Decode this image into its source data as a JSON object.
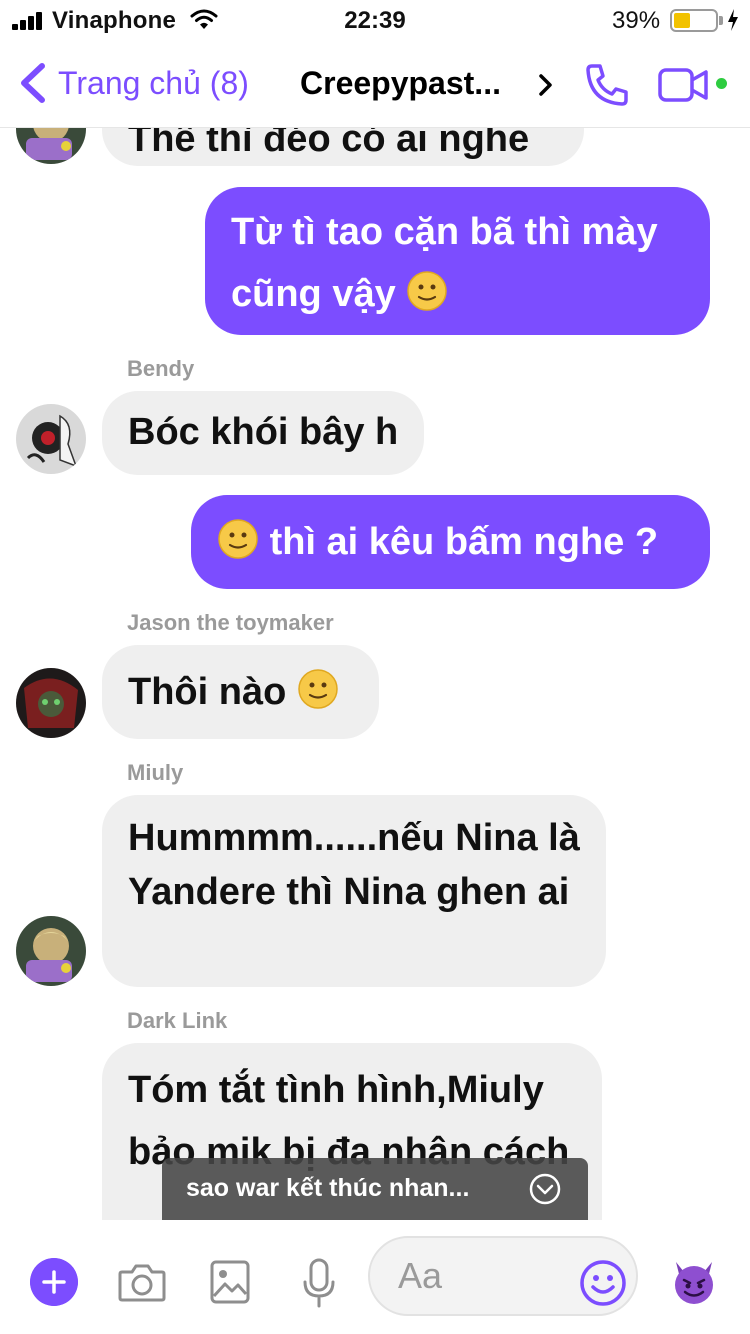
{
  "status_bar": {
    "carrier": "Vinaphone",
    "time": "22:39",
    "battery": "39%",
    "battery_level": 0.39,
    "battery_color": "#f2c200"
  },
  "header": {
    "back_label": "Trang chủ (8)",
    "title": "Creepypast...",
    "accent": "#7c4dff"
  },
  "messages": [
    {
      "text": "Thế thì đéo có ai nghe"
    },
    {
      "text": "Từ tì tao cặn bã thì mày cũng vậy"
    },
    {
      "sender": "Bendy",
      "text": "Bóc khói bây h"
    },
    {
      "text": "thì ai kêu bấm nghe ?"
    },
    {
      "sender": "Jason the toymaker",
      "text": "Thôi nào"
    },
    {
      "sender": "Miuly",
      "text": "Hummmm......nếu Nina là Yandere thì Nina ghen ai"
    },
    {
      "sender": "Dark Link",
      "text": "Tóm tắt tình hình,Miuly bảo mik bị đa nhân cách"
    }
  ],
  "toast": {
    "text": "sao war kết thúc nhan..."
  },
  "composer": {
    "placeholder": "Aa"
  },
  "icons": [
    "back-chevron-icon",
    "phone-icon",
    "video-camera-icon",
    "plus-icon",
    "camera-icon",
    "image-icon",
    "microphone-icon",
    "smile-icon",
    "devil-emoji-icon",
    "chevron-down-circle-icon"
  ]
}
